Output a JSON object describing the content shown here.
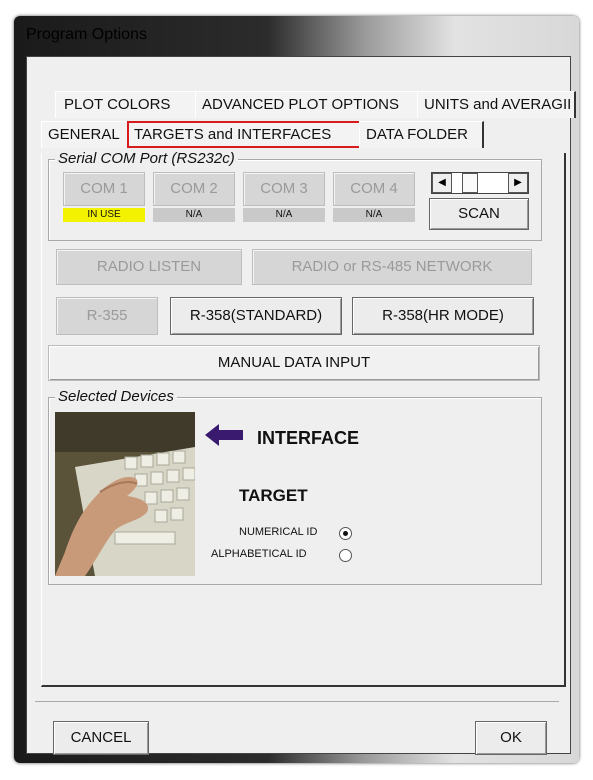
{
  "window": {
    "title": "Program Options"
  },
  "tabs_row1": [
    "PLOT COLORS",
    "ADVANCED PLOT OPTIONS",
    "UNITS and AVERAGII"
  ],
  "tabs_row2": [
    "GENERAL",
    "TARGETS and INTERFACES",
    "DATA FOLDER"
  ],
  "active_tab": "TARGETS and INTERFACES",
  "serial": {
    "legend": "Serial COM Port (RS232c)",
    "ports": [
      {
        "label": "COM 1",
        "status": "IN USE"
      },
      {
        "label": "COM 2",
        "status": "N/A"
      },
      {
        "label": "COM 3",
        "status": "N/A"
      },
      {
        "label": "COM 4",
        "status": "N/A"
      }
    ],
    "scan": "SCAN",
    "highlight": "#f3f200"
  },
  "interfaces": {
    "radio_listen": "RADIO LISTEN",
    "radio_network": "RADIO or RS-485 NETWORK",
    "r355": "R-355",
    "r358_standard": "R-358(STANDARD)",
    "r358_hr": "R-358(HR MODE)",
    "manual": "MANUAL DATA INPUT"
  },
  "selected": {
    "legend": "Selected Devices",
    "interface_label": "INTERFACE",
    "target_label": "TARGET",
    "options": [
      {
        "label": "NUMERICAL ID",
        "checked": true
      },
      {
        "label": "ALPHABETICAL ID",
        "checked": false
      }
    ]
  },
  "footer": {
    "cancel": "CANCEL",
    "ok": "OK"
  },
  "colors": {
    "accent_red": "#d81b1b",
    "arrow": "#3a1a6e"
  }
}
